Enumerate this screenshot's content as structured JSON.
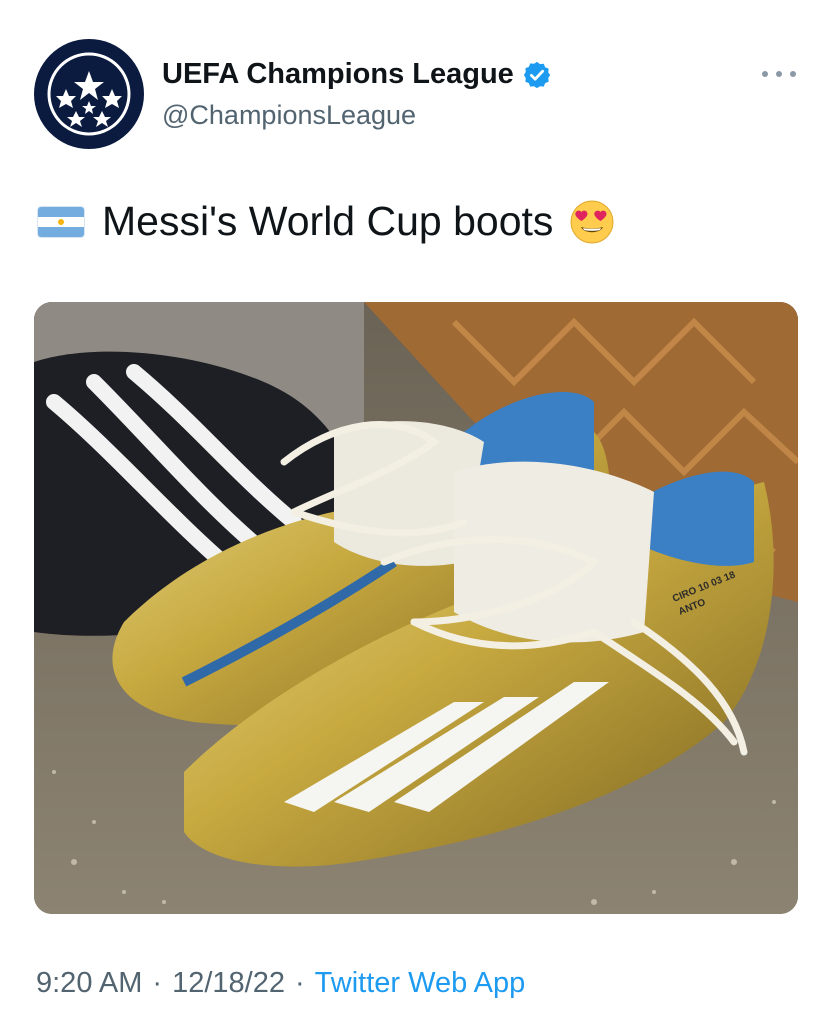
{
  "author": {
    "display_name": "UEFA Champions League",
    "handle": "@ChampionsLeague",
    "avatar_icon": "starball-logo-icon",
    "verified_icon": "verified-badge-icon"
  },
  "tweet": {
    "flag_icon": "argentina-flag-icon",
    "text": "Messi's World Cup boots",
    "emoji_icon": "heart-eyes-emoji-icon"
  },
  "media": {
    "boot_print": [
      "CIRO 10 03 18",
      "ANTO"
    ]
  },
  "footer": {
    "time": "9:20 AM",
    "separator": "·",
    "date": "12/18/22",
    "app": "Twitter Web App"
  },
  "colors": {
    "link": "#1d9bf0",
    "secondary_text": "#536471",
    "verified": "#1d9bf0",
    "avatar_bg": "#0b1a3f"
  }
}
